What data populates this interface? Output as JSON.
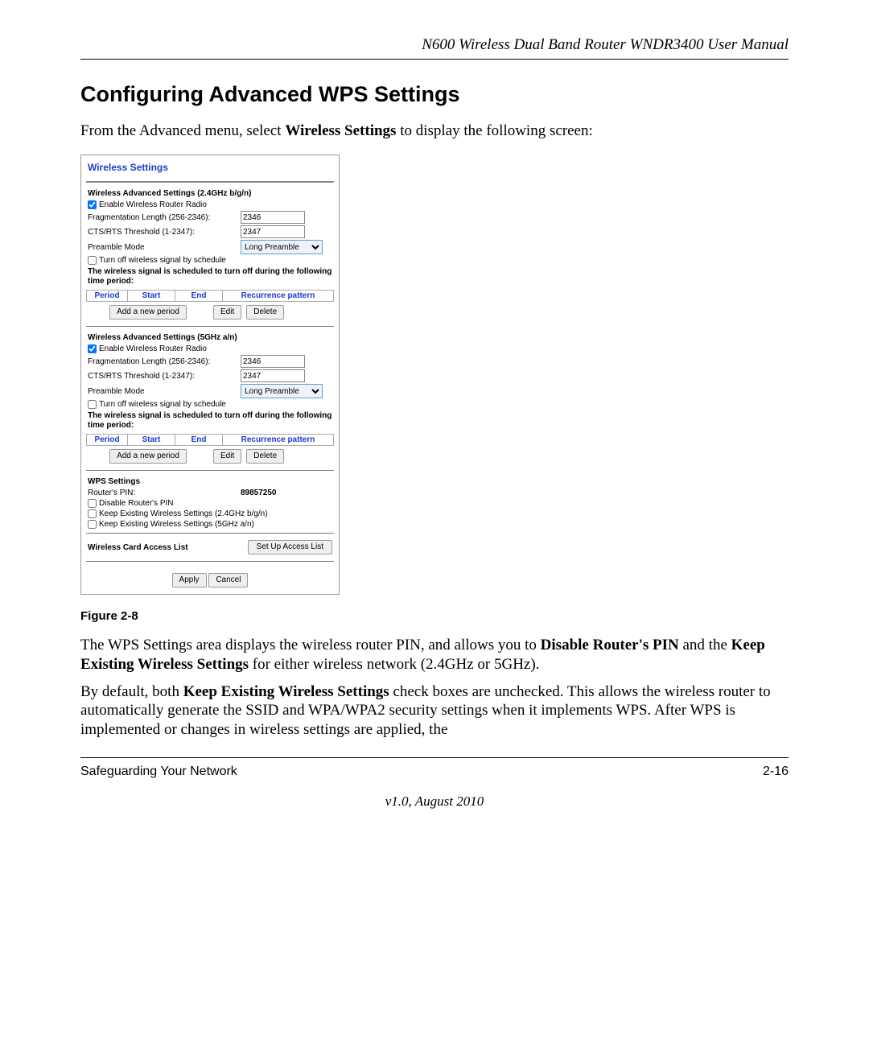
{
  "doc": {
    "header_title": "N600 Wireless Dual Band Router WNDR3400 User Manual",
    "section_heading": "Configuring Advanced WPS Settings",
    "intro_prefix": "From the Advanced menu, select ",
    "intro_bold": "Wireless Settings",
    "intro_suffix": " to display the following screen:",
    "figure_caption": "Figure 2-8",
    "para1_a": "The WPS Settings area displays the wireless router PIN, and allows you to ",
    "para1_b": "Disable Router's PIN",
    "para1_c": " and the ",
    "para1_d": "Keep Existing Wireless Settings",
    "para1_e": " for either wireless network (2.4GHz or 5GHz).",
    "para2_a": "By default, both ",
    "para2_b": "Keep Existing Wireless Settings",
    "para2_c": " check boxes are unchecked. This allows the wireless router to automatically generate the SSID and WPA/WPA2 security settings when it implements WPS. After WPS is implemented or changes in wireless settings are applied, the",
    "footer_left": "Safeguarding Your Network",
    "footer_right": "2-16",
    "version": "v1.0, August 2010"
  },
  "shot": {
    "title": "Wireless Settings",
    "section24_title": "Wireless Advanced Settings (2.4GHz b/g/n)",
    "enable_radio": "Enable Wireless Router Radio",
    "frag_label": "Fragmentation Length (256-2346):",
    "frag_value": "2346",
    "cts_label": "CTS/RTS Threshold (1-2347):",
    "cts_value": "2347",
    "preamble_label": "Preamble Mode",
    "preamble_value": "Long Preamble",
    "turnoff_label": "Turn off wireless signal by schedule",
    "schedule_note": "The wireless signal is scheduled to turn off during the following time period:",
    "col_period": "Period",
    "col_start": "Start",
    "col_end": "End",
    "col_recur": "Recurrence pattern",
    "btn_add": "Add a new period",
    "btn_edit": "Edit",
    "btn_delete": "Delete",
    "section5_title": "Wireless Advanced Settings (5GHz a/n)",
    "wps_title": "WPS Settings",
    "pin_label": "Router's PIN:",
    "pin_value": "89857250",
    "disable_pin": "Disable Router's PIN",
    "keep24": "Keep Existing Wireless Settings (2.4GHz b/g/n)",
    "keep5": "Keep Existing Wireless Settings (5GHz a/n)",
    "access_label": "Wireless Card Access List",
    "access_btn": "Set Up Access List",
    "apply": "Apply",
    "cancel": "Cancel"
  }
}
